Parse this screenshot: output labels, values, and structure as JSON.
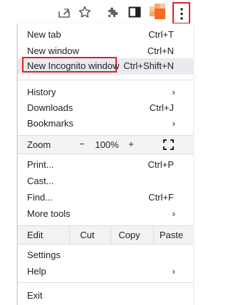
{
  "toolbar": {
    "icons": [
      "share-icon",
      "star-icon",
      "extensions-puzzle-icon",
      "side-panel-icon",
      "profile-avatar",
      "kebab-menu-icon"
    ],
    "avatar_colors": [
      "#f36c21",
      "#f9a86b",
      "#f7c8a3"
    ],
    "highlight_color": "#e0202a"
  },
  "menu": {
    "new_tab": {
      "label": "New tab",
      "shortcut": "Ctrl+T"
    },
    "new_window": {
      "label": "New window",
      "shortcut": "Ctrl+N"
    },
    "new_incognito": {
      "label": "New Incognito window",
      "shortcut": "Ctrl+Shift+N"
    },
    "history": {
      "label": "History",
      "arrow": "›"
    },
    "downloads": {
      "label": "Downloads",
      "shortcut": "Ctrl+J"
    },
    "bookmarks": {
      "label": "Bookmarks",
      "arrow": "›"
    },
    "zoom": {
      "label": "Zoom",
      "minus": "−",
      "value": "100%",
      "plus": "+",
      "fullscreen_icon": "fullscreen-icon"
    },
    "print": {
      "label": "Print...",
      "shortcut": "Ctrl+P"
    },
    "cast": {
      "label": "Cast..."
    },
    "find": {
      "label": "Find...",
      "shortcut": "Ctrl+F"
    },
    "more_tools": {
      "label": "More tools",
      "arrow": "›"
    },
    "edit": {
      "label": "Edit",
      "cut": "Cut",
      "copy": "Copy",
      "paste": "Paste"
    },
    "settings": {
      "label": "Settings"
    },
    "help": {
      "label": "Help",
      "arrow": "›"
    },
    "exit": {
      "label": "Exit"
    }
  }
}
